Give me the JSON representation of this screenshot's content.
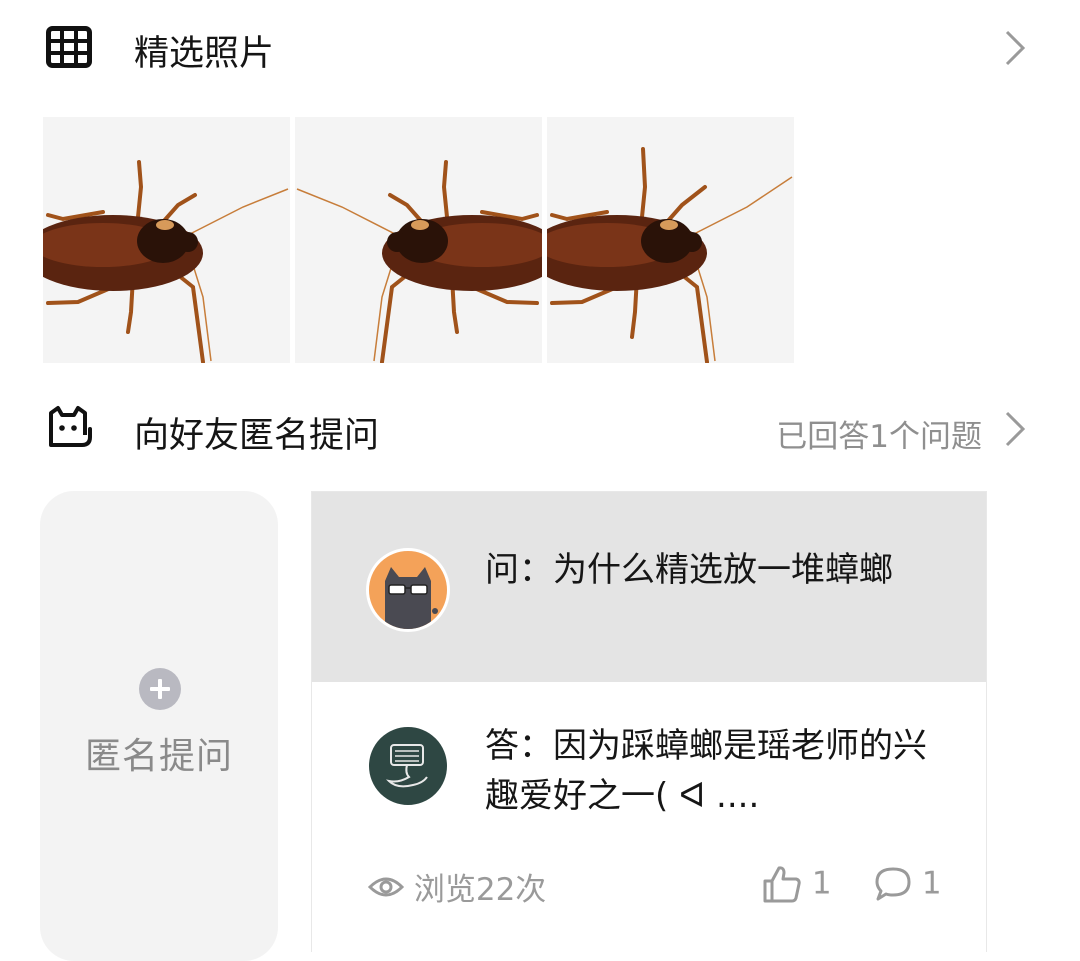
{
  "featured": {
    "title": "精选照片",
    "icon": "grid-icon",
    "photo_count": 3
  },
  "anonymous_question": {
    "title": "向好友匿名提问",
    "icon": "cat-face-icon",
    "answered_text": "已回答1个问题",
    "ask_label": "匿名提问",
    "card": {
      "question": "问：为什么精选放一堆蟑螂",
      "answer": "答：因为踩蟑螂是瑶老师的兴趣爱好之一( ᐊ ....",
      "views": "浏览22次",
      "likes": "1",
      "comments": "1"
    }
  },
  "colors": {
    "accent_orange": "#f4a259",
    "dark_green": "#2e4743",
    "muted_text": "#8f8f8f"
  }
}
